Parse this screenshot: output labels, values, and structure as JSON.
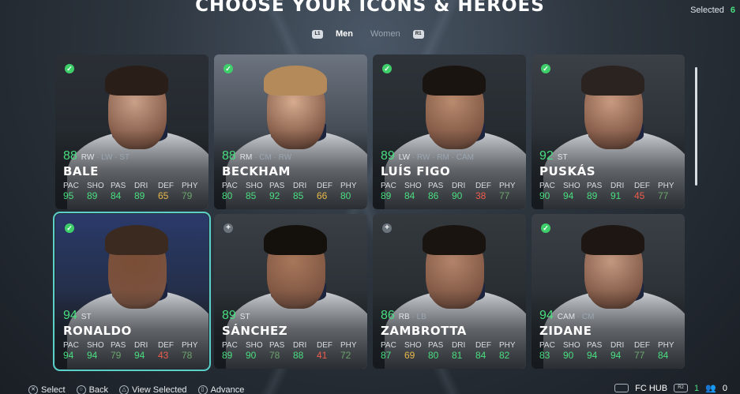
{
  "header": {
    "title": "CHOOSE YOUR ICONS & HEROES",
    "selected_label": "Selected",
    "selected_count": "6"
  },
  "tabs": {
    "left_button": "L1",
    "right_button": "R1",
    "items": [
      {
        "label": "Men"
      },
      {
        "label": "Women"
      }
    ]
  },
  "stat_labels": [
    "PAC",
    "SHO",
    "PAS",
    "DRI",
    "DEF",
    "PHY"
  ],
  "players": [
    {
      "ovr": "88",
      "pos": "RW",
      "alt": " · LW · ST",
      "name": "BALE",
      "stats": [
        "95",
        "89",
        "84",
        "89",
        "65",
        "79"
      ],
      "selected": true
    },
    {
      "ovr": "88",
      "pos": "RM",
      "alt": " · CM · RW",
      "name": "BECKHAM",
      "stats": [
        "80",
        "85",
        "92",
        "85",
        "66",
        "80"
      ],
      "selected": true
    },
    {
      "ovr": "89",
      "pos": "LW",
      "alt": " · RW · RM · CAM",
      "name": "LUÍS FIGO",
      "stats": [
        "89",
        "84",
        "86",
        "90",
        "38",
        "77"
      ],
      "selected": true
    },
    {
      "ovr": "92",
      "pos": "ST",
      "alt": "",
      "name": "PUSKÁS",
      "stats": [
        "90",
        "94",
        "89",
        "91",
        "45",
        "77"
      ],
      "selected": true
    },
    {
      "ovr": "94",
      "pos": "ST",
      "alt": "",
      "name": "RONALDO",
      "stats": [
        "94",
        "94",
        "79",
        "94",
        "43",
        "78"
      ],
      "selected": true
    },
    {
      "ovr": "89",
      "pos": "ST",
      "alt": "",
      "name": "SÁNCHEZ",
      "stats": [
        "89",
        "90",
        "78",
        "88",
        "41",
        "72"
      ],
      "selected": false
    },
    {
      "ovr": "86",
      "pos": "RB",
      "alt": " · LB",
      "name": "ZAMBROTTA",
      "stats": [
        "87",
        "69",
        "80",
        "81",
        "84",
        "82"
      ],
      "selected": false
    },
    {
      "ovr": "94",
      "pos": "CAM",
      "alt": " · CM",
      "name": "ZIDANE",
      "stats": [
        "83",
        "90",
        "94",
        "94",
        "77",
        "84"
      ],
      "selected": true
    }
  ],
  "footer": {
    "actions": [
      {
        "button": "✕",
        "label": "Select"
      },
      {
        "button": "○",
        "label": "Back"
      },
      {
        "button": "△",
        "label": "View Selected"
      },
      {
        "button": "▯",
        "label": "Advance"
      }
    ],
    "hub_button": "",
    "hub_label": "FC HUB",
    "r2_label": "R2",
    "coins": "1",
    "friends": "0"
  }
}
